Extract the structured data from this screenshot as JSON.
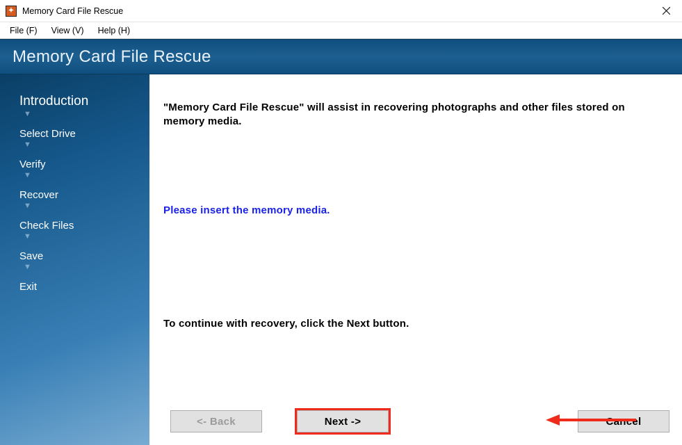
{
  "window": {
    "title": "Memory Card File Rescue"
  },
  "menu": {
    "file": "File (F)",
    "view": "View (V)",
    "help": "Help (H)"
  },
  "banner": {
    "title": "Memory Card File Rescue"
  },
  "sidebar": {
    "steps": {
      "intro": "Introduction",
      "select_drive": "Select Drive",
      "verify": "Verify",
      "recover": "Recover",
      "check_files": "Check Files",
      "save": "Save",
      "exit": "Exit"
    }
  },
  "content": {
    "desc_prefix": "\"Memory Card File Rescue\"",
    "desc_rest": " will assist in recovering photographs and other files stored on memory media.",
    "prompt": "Please insert the memory media.",
    "continue": "To continue with recovery, click the Next button."
  },
  "buttons": {
    "back": "<- Back",
    "next": "Next ->",
    "cancel": "Cancel"
  }
}
